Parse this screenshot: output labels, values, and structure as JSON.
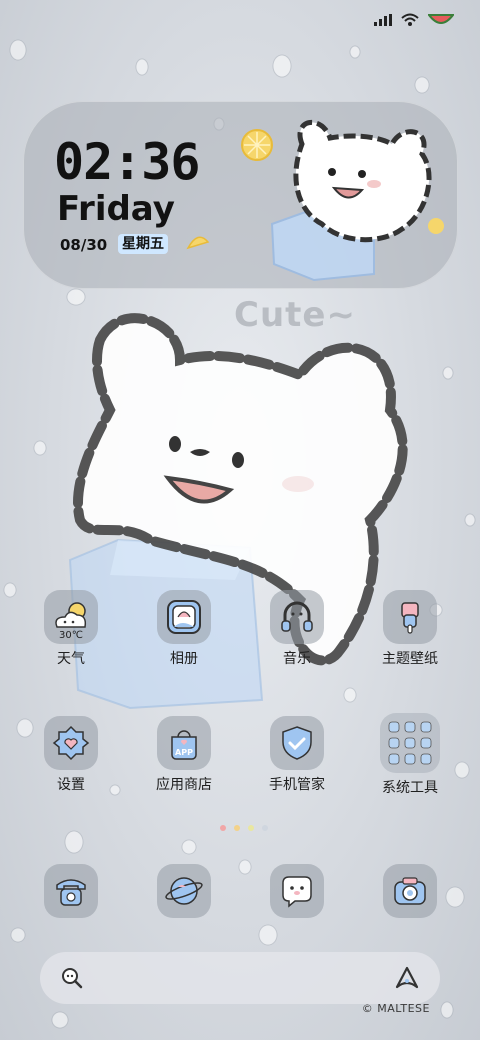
{
  "status_bar": {
    "icons": [
      "signal-icon",
      "wifi-icon",
      "battery-icon"
    ]
  },
  "clock_widget": {
    "time": "02:36",
    "weekday": "Friday",
    "date": "08/30",
    "lunar_weekday": "星期五"
  },
  "wallpaper": {
    "caption": "Cute~"
  },
  "apps": [
    {
      "label": "天气",
      "icon": "weather-icon",
      "temp": "30℃"
    },
    {
      "label": "相册",
      "icon": "gallery-icon"
    },
    {
      "label": "音乐",
      "icon": "music-icon"
    },
    {
      "label": "主题壁纸",
      "icon": "theme-icon"
    },
    {
      "label": "设置",
      "icon": "settings-icon"
    },
    {
      "label": "应用商店",
      "icon": "app-store-icon",
      "badge": "APP"
    },
    {
      "label": "手机管家",
      "icon": "security-shield-icon"
    },
    {
      "label": "系统工具",
      "icon": "system-tools-folder-icon"
    }
  ],
  "page_indicator": {
    "pages": 4,
    "active": 0,
    "colors": [
      "#f1a6a6",
      "#f3d28a",
      "#e9e7a0",
      "#cfd6df"
    ]
  },
  "dock": [
    {
      "icon": "phone-icon"
    },
    {
      "icon": "browser-icon"
    },
    {
      "icon": "messages-icon"
    },
    {
      "icon": "camera-icon"
    }
  ],
  "search_bar": {
    "left_icon": "search-icon",
    "right_icon": "assistant-icon"
  },
  "watermark": "© MALTESE"
}
